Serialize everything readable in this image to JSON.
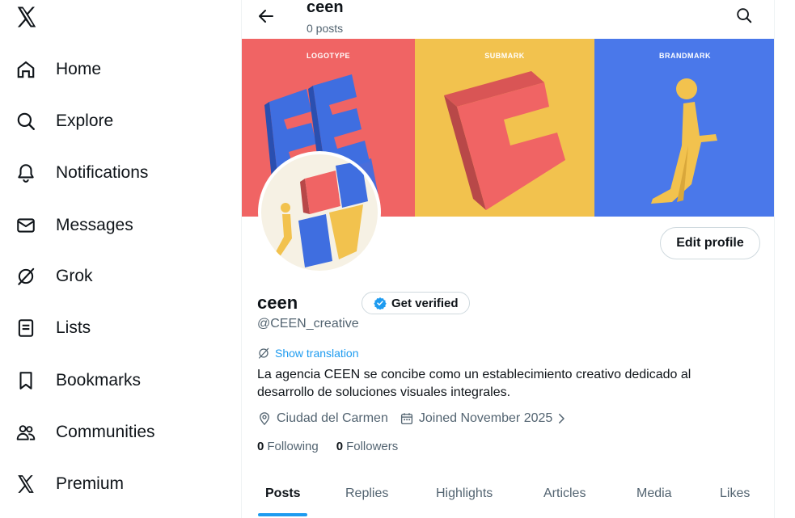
{
  "sidebar": {
    "logo_icon": "x-logo-icon",
    "items": [
      {
        "label": "Home",
        "icon": "home-icon"
      },
      {
        "label": "Explore",
        "icon": "search-icon"
      },
      {
        "label": "Notifications",
        "icon": "bell-icon"
      },
      {
        "label": "Messages",
        "icon": "envelope-icon"
      },
      {
        "label": "Grok",
        "icon": "grok-icon"
      },
      {
        "label": "Lists",
        "icon": "list-icon"
      },
      {
        "label": "Bookmarks",
        "icon": "bookmark-icon"
      },
      {
        "label": "Communities",
        "icon": "people-icon"
      },
      {
        "label": "Premium",
        "icon": "x-logo-icon"
      }
    ]
  },
  "header": {
    "name": "ceen",
    "post_count": "0 posts"
  },
  "banner": {
    "panels": [
      {
        "title": "LOGOTYPE"
      },
      {
        "title": "SUBMARK"
      },
      {
        "title": "BRANDMARK"
      }
    ]
  },
  "profile": {
    "name": "ceen",
    "handle": "@CEEN_creative",
    "get_verified_label": "Get verified",
    "edit_profile_label": "Edit profile",
    "show_translation": "Show translation",
    "bio": "La agencia CEEN se concibe como un establecimiento creativo dedicado al desarrollo de soluciones visuales integrales.",
    "location": "Ciudad del Carmen",
    "joined": "Joined November 2025",
    "following_count": "0",
    "following_label": "Following",
    "followers_count": "0",
    "followers_label": "Followers"
  },
  "tabs": [
    {
      "label": "Posts",
      "active": true
    },
    {
      "label": "Replies",
      "active": false
    },
    {
      "label": "Highlights",
      "active": false
    },
    {
      "label": "Articles",
      "active": false
    },
    {
      "label": "Media",
      "active": false
    },
    {
      "label": "Likes",
      "active": false
    }
  ],
  "colors": {
    "accent": "#1d9bf0",
    "banner_red": "#f06464",
    "banner_yellow": "#f2c24e",
    "banner_blue": "#4a78ea"
  }
}
